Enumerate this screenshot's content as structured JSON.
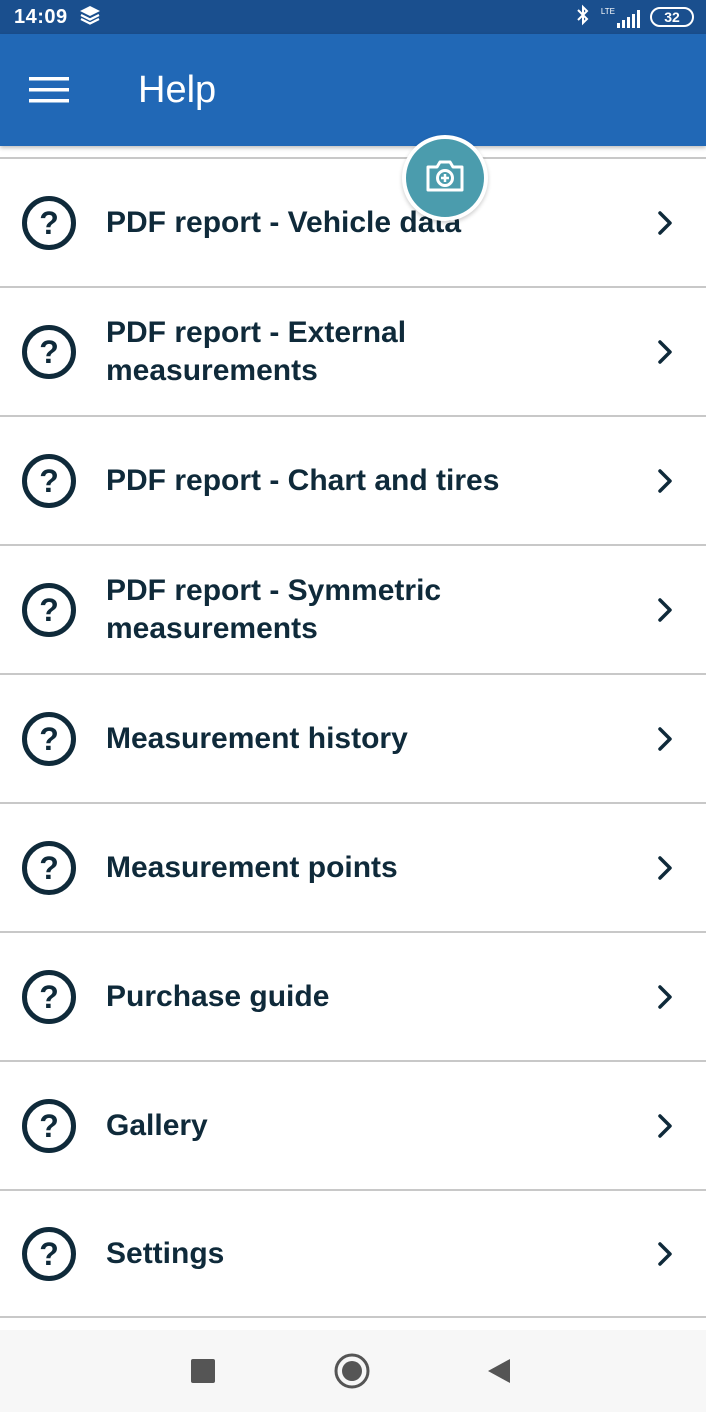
{
  "status_bar": {
    "time": "14:09",
    "network": "LTE",
    "battery": "32",
    "icons": [
      "layers-icon",
      "bluetooth-icon",
      "signal-icon",
      "battery-icon"
    ]
  },
  "app_bar": {
    "title": "Help",
    "menu_icon": "hamburger-menu-icon",
    "color": "#2168b6"
  },
  "fab": {
    "icon": "camera-icon",
    "color": "#4b9cad"
  },
  "help_items": [
    {
      "label": "PDF report - Vehicle data"
    },
    {
      "label": "PDF report - External measurements"
    },
    {
      "label": "PDF report - Chart and tires"
    },
    {
      "label": "PDF report - Symmetric measurements"
    },
    {
      "label": "Measurement history"
    },
    {
      "label": "Measurement points"
    },
    {
      "label": "Purchase guide"
    },
    {
      "label": "Gallery"
    },
    {
      "label": "Settings"
    }
  ],
  "nav_bar": {
    "buttons": [
      "recents-square-icon",
      "home-circle-icon",
      "back-triangle-icon"
    ]
  }
}
